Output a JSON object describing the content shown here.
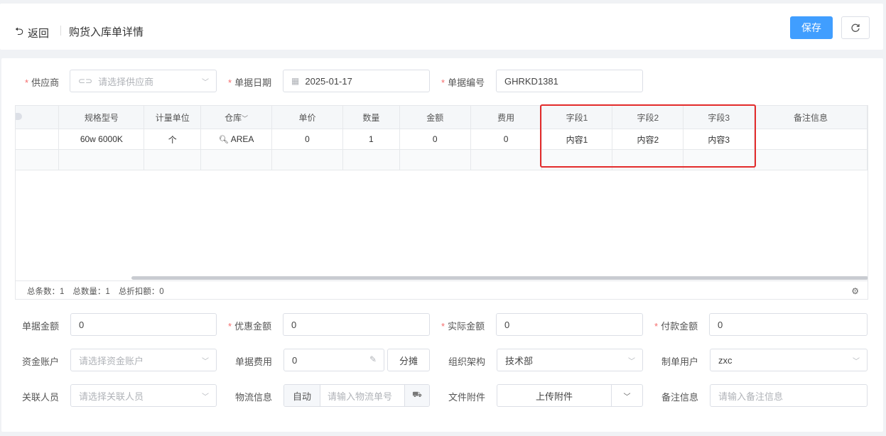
{
  "header": {
    "back_label": "返回",
    "title": "购货入库单详情",
    "save_label": "保存"
  },
  "form": {
    "supplier": {
      "label": "供应商",
      "placeholder": "请选择供应商"
    },
    "date": {
      "label": "单据日期",
      "value": "2025-01-17"
    },
    "code": {
      "label": "单据编号",
      "value": "GHRKD1381"
    }
  },
  "table": {
    "columns": [
      "规格型号",
      "计量单位",
      "仓库",
      "单价",
      "数量",
      "金额",
      "费用",
      "字段1",
      "字段2",
      "字段3",
      "备注信息"
    ],
    "rows": [
      [
        "60w 6000K",
        "个",
        "AREA",
        "0",
        "1",
        "0",
        "0",
        "内容1",
        "内容2",
        "内容3",
        ""
      ]
    ],
    "footer": {
      "total_rows": "总条数：1",
      "total_qty": "总数量：1",
      "total_discount": "总折扣额：0"
    }
  },
  "bottom": {
    "doc_amount": {
      "label": "单据金额",
      "value": "0"
    },
    "discount_amount": {
      "label": "优惠金额",
      "value": "0"
    },
    "actual_amount": {
      "label": "实际金额",
      "value": "0"
    },
    "pay_amount": {
      "label": "付款金额",
      "value": "0"
    },
    "fund_account": {
      "label": "资金账户",
      "placeholder": "请选择资金账户"
    },
    "doc_fee": {
      "label": "单据费用",
      "value": "0",
      "split_label": "分摊"
    },
    "org": {
      "label": "组织架构",
      "value": "技术部"
    },
    "creator": {
      "label": "制单用户",
      "value": "zxc"
    },
    "related_person": {
      "label": "关联人员",
      "placeholder": "请选择关联人员"
    },
    "logistics": {
      "label": "物流信息",
      "auto_label": "自动",
      "placeholder": "请输入物流单号"
    },
    "attachment": {
      "label": "文件附件",
      "upload_label": "上传附件"
    },
    "remark": {
      "label": "备注信息",
      "placeholder": "请输入备注信息"
    }
  },
  "accent_color": "#409eff",
  "highlight_color": "#e32b2b"
}
